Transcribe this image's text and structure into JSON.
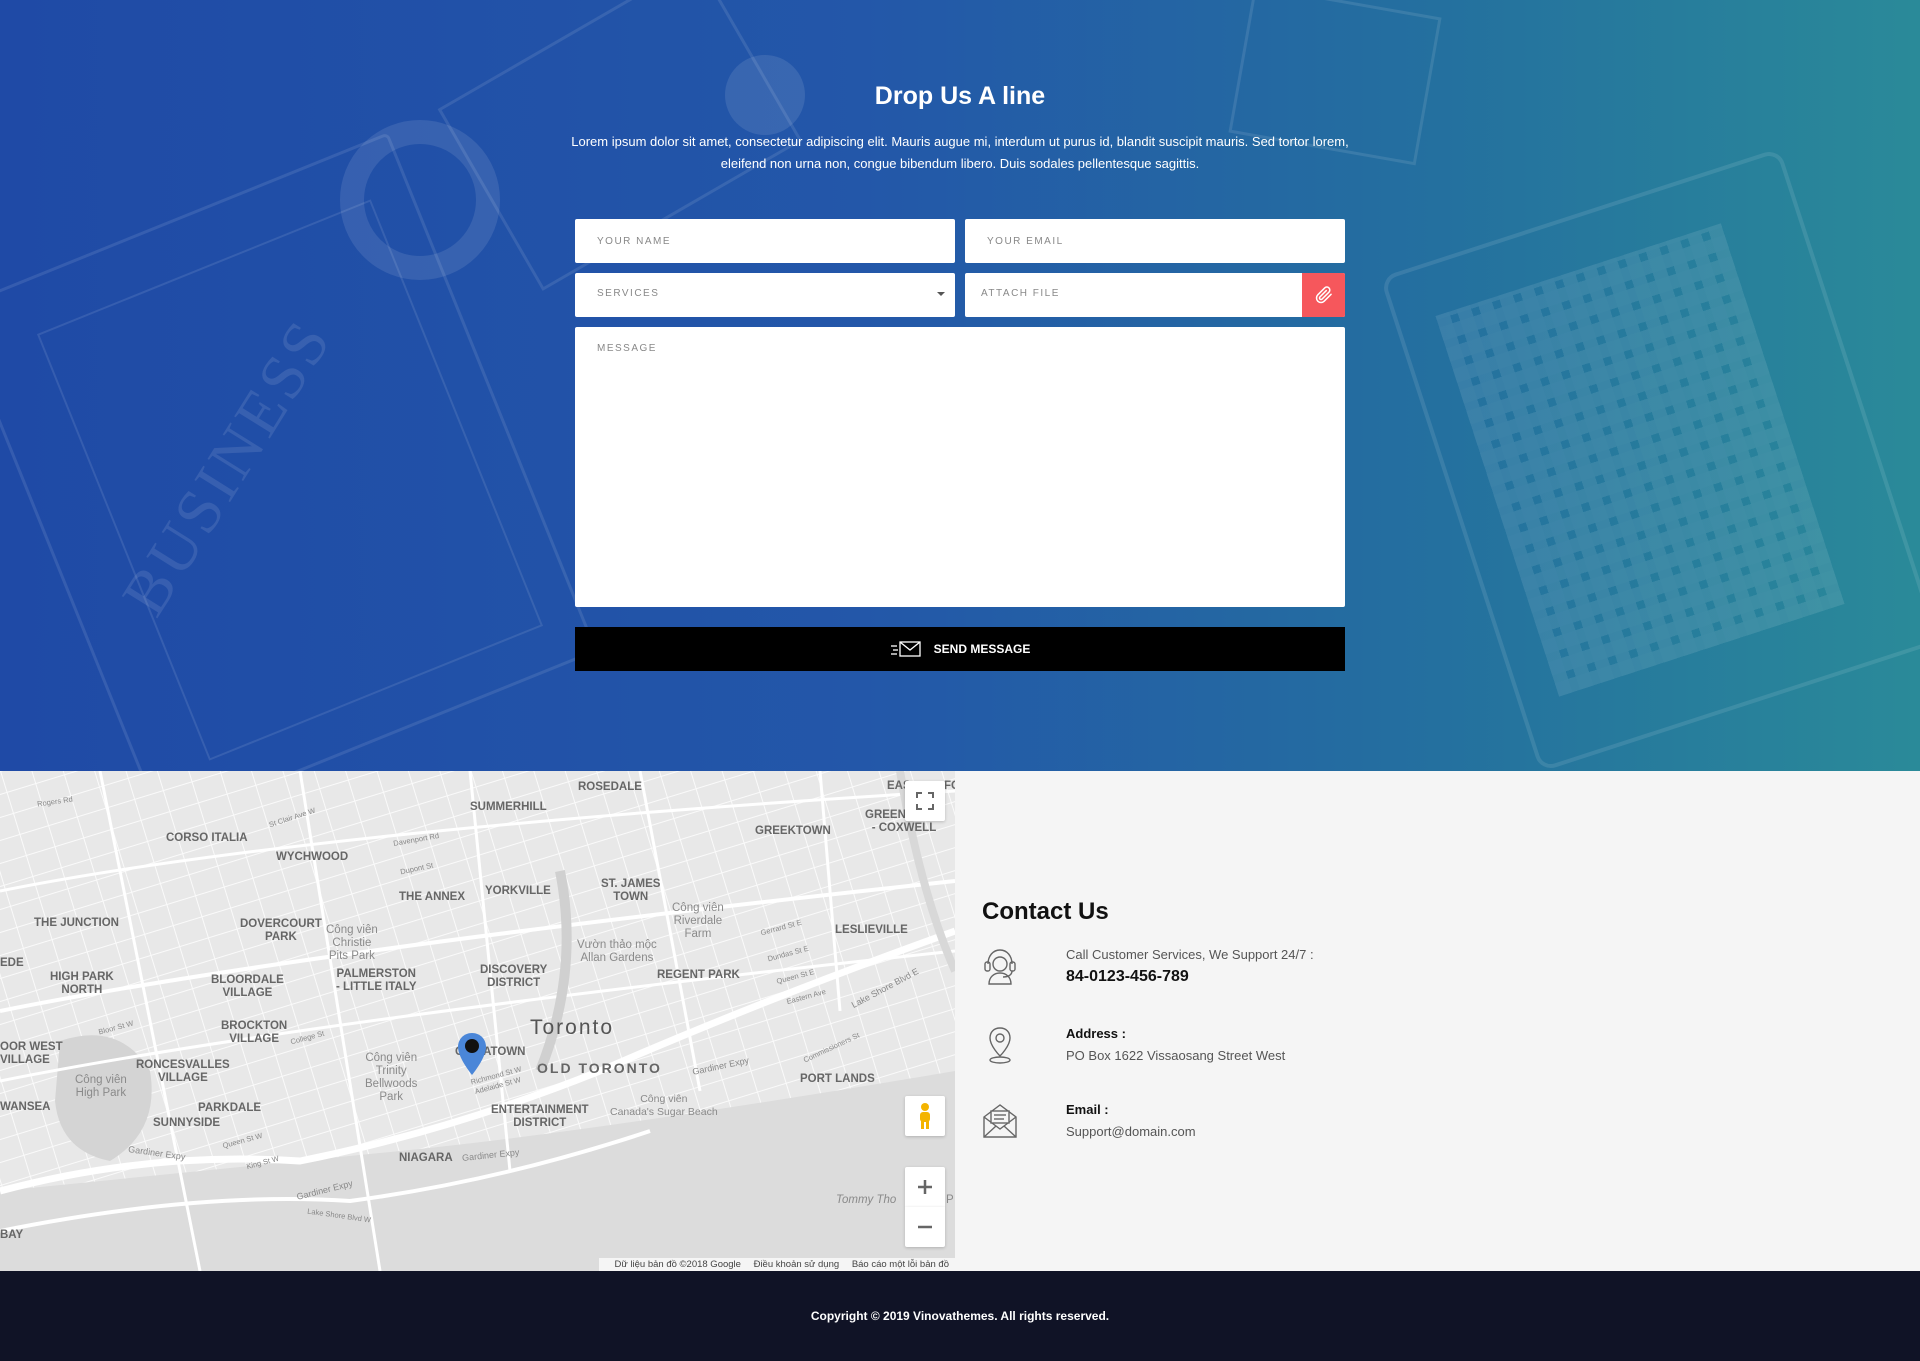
{
  "hero": {
    "title": "Drop Us A line",
    "description": "Lorem ipsum dolor sit amet, consectetur adipiscing elit. Mauris augue mi, interdum ut purus id, blandit suscipit mauris. Sed tortor lorem, eleifend non urna non, congue bibendum libero. Duis sodales pellentesque sagittis.",
    "background_start": "#1f4aa6",
    "background_end": "#2a8a99",
    "decor_text": "BUSINESS"
  },
  "form": {
    "name_placeholder": "YOUR NAME",
    "email_placeholder": "YOUR EMAIL",
    "services_selected": "SERVICES",
    "attach_label": "ATTACH FILE",
    "attach_icon": "paperclip-icon",
    "attach_color": "#f6575c",
    "message_placeholder": "MESSAGE",
    "send_label": "SEND MESSAGE",
    "send_icon": "envelope-icon"
  },
  "map": {
    "labels": {
      "rosedale": "ROSEDALE",
      "summerhill": "SUMMERHILL",
      "eas": "EAS",
      "fo": "FO",
      "corso_italia": "CORSO ITALIA",
      "wychwood": "WYCHWOOD",
      "greektown": "GREEKTOWN",
      "greenwood": "GREENWOOD\n- COXWELL",
      "the_annex": "THE ANNEX",
      "yorkville": "YORKVILLE",
      "st_james": "ST. JAMES\nTOWN",
      "the_junction": "THE JUNCTION",
      "dovercourt": "DOVERCOURT\nPARK",
      "christie_park": "Công viên\nChristie\nPits Park",
      "riverdale_park": "Công viên\nRiverdale\nFarm",
      "leslieville": "LESLIEVILLE",
      "allan_gardens": "Vườn thảo mộc\nAllan Gardens",
      "ede": "EDE",
      "high_park_north": "HIGH PARK\nNORTH",
      "bloordale": "BLOORDALE\nVILLAGE",
      "palmerston": "PALMERSTON\n- LITTLE ITALY",
      "discovery": "DISCOVERY\nDISTRICT",
      "regent_park": "REGENT PARK",
      "brockton": "BROCKTON\nVILLAGE",
      "toronto": "Toronto",
      "chinatown": "CHINATOWN",
      "roor_west": "OOR WEST\nVILLAGE",
      "roncesvalles": "RONCESVALLES\nVILLAGE",
      "trinity": "Công viên\nTrinity\nBellwoods\nPark",
      "old_toronto": "OLD TORONTO",
      "high_park": "Công viên\nHigh Park",
      "port_lands": "PORT LANDS",
      "wansea": "WANSEA",
      "parkdale": "PARKDALE",
      "sunnyside": "SUNNYSIDE",
      "entertainment": "ENTERTAINMENT\nDISTRICT",
      "sugar_beach": "Công viên\nCanada's Sugar Beach",
      "niagara": "NIAGARA",
      "tommy": "Tommy Tho",
      "bay": "BAY",
      "p": "P",
      "gardiner1": "Gardiner Expy",
      "gardiner2": "Gardiner Expy",
      "gardiner3": "Gardiner Expy",
      "gardiner4": "Gardiner Expy",
      "lake_shore": "Lake Shore Blvd E",
      "lake_shore_w": "Lake Shore Blvd W",
      "st_clair": "St Clair Ave W",
      "davenport": "Davenport Rd",
      "dupont": "Dupont St",
      "bloor": "Bloor St W",
      "college": "College St",
      "queen_w": "Queen St W",
      "king_w": "King St W",
      "dundas_e": "Dundas St E",
      "queen_e": "Queen St E",
      "gerrard": "Gerrard St E",
      "eastern": "Eastern Ave",
      "commissioners": "Commissioners St",
      "rogers": "Rogers Rd",
      "richmond": "Richmond St W",
      "adelaide": "Adelaide St W"
    },
    "credit_data": "Dữ liệu bản đồ ©2018 Google",
    "credit_terms": "Điều khoản sử dụng",
    "credit_report": "Báo cáo một lỗi bản đồ",
    "marker_color": "#4a86d8"
  },
  "contact": {
    "title": "Contact Us",
    "phone_label": "Call Customer Services, We Support 24/7 :",
    "phone": "84-0123-456-789",
    "address_label": "Address :",
    "address": "PO Box 1622 Vissaosang Street West",
    "email_label": "Email :",
    "email": "Support@domain.com"
  },
  "footer": {
    "copyright": "Copyright © 2019 Vinovathemes. All rights reserved.",
    "background": "#101326"
  }
}
